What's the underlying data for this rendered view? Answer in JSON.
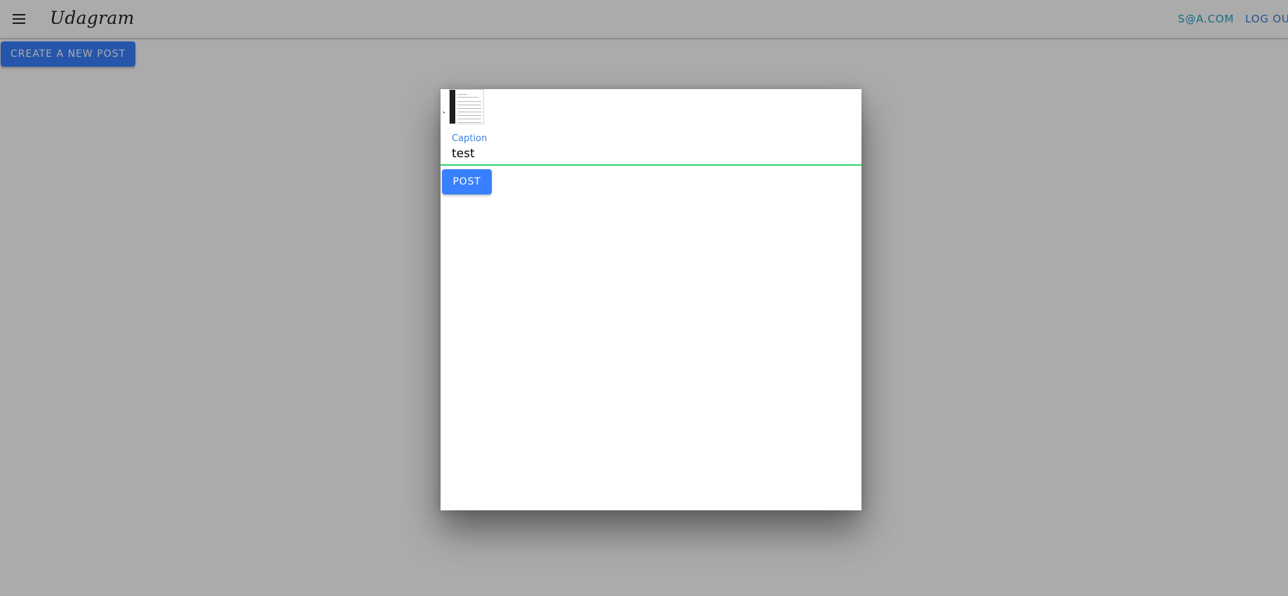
{
  "header": {
    "brand": "Udagram",
    "menu_icon": "menu-icon",
    "user_email": "S@A.COM",
    "logout_label": "LOG OUT"
  },
  "main": {
    "create_post_label": "CREATE A NEW POST"
  },
  "modal": {
    "backtick": "`",
    "caption_label": "Caption",
    "caption_value": "test",
    "post_label": "POST"
  },
  "colors": {
    "primary": "#3880ff",
    "email_link": "#1fa2c4",
    "logout_link": "#3b7ddd",
    "valid_underline": "#2dd36f"
  }
}
